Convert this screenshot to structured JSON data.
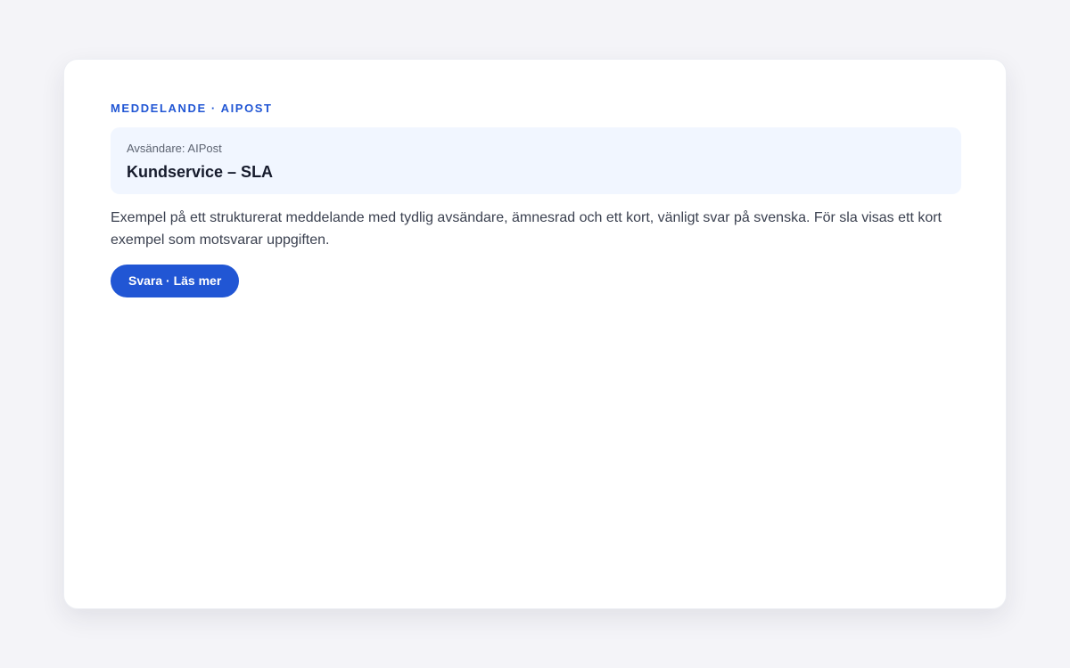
{
  "card": {
    "eyebrow": "Meddelande · AIPost",
    "header": {
      "sender": "Avsändare: AIPost",
      "subject": "Kundservice – SLA"
    },
    "body": "Exempel på ett strukturerat meddelande med tydlig avsändare, ämnesrad och ett kort, vänligt svar på svenska. För sla visas ett kort exempel som motsvarar uppgiften.",
    "button_label": "Svara · Läs mer"
  },
  "colors": {
    "accent": "#2156d4",
    "header_background": "#f1f6ff",
    "page_background": "#f4f4f8"
  }
}
